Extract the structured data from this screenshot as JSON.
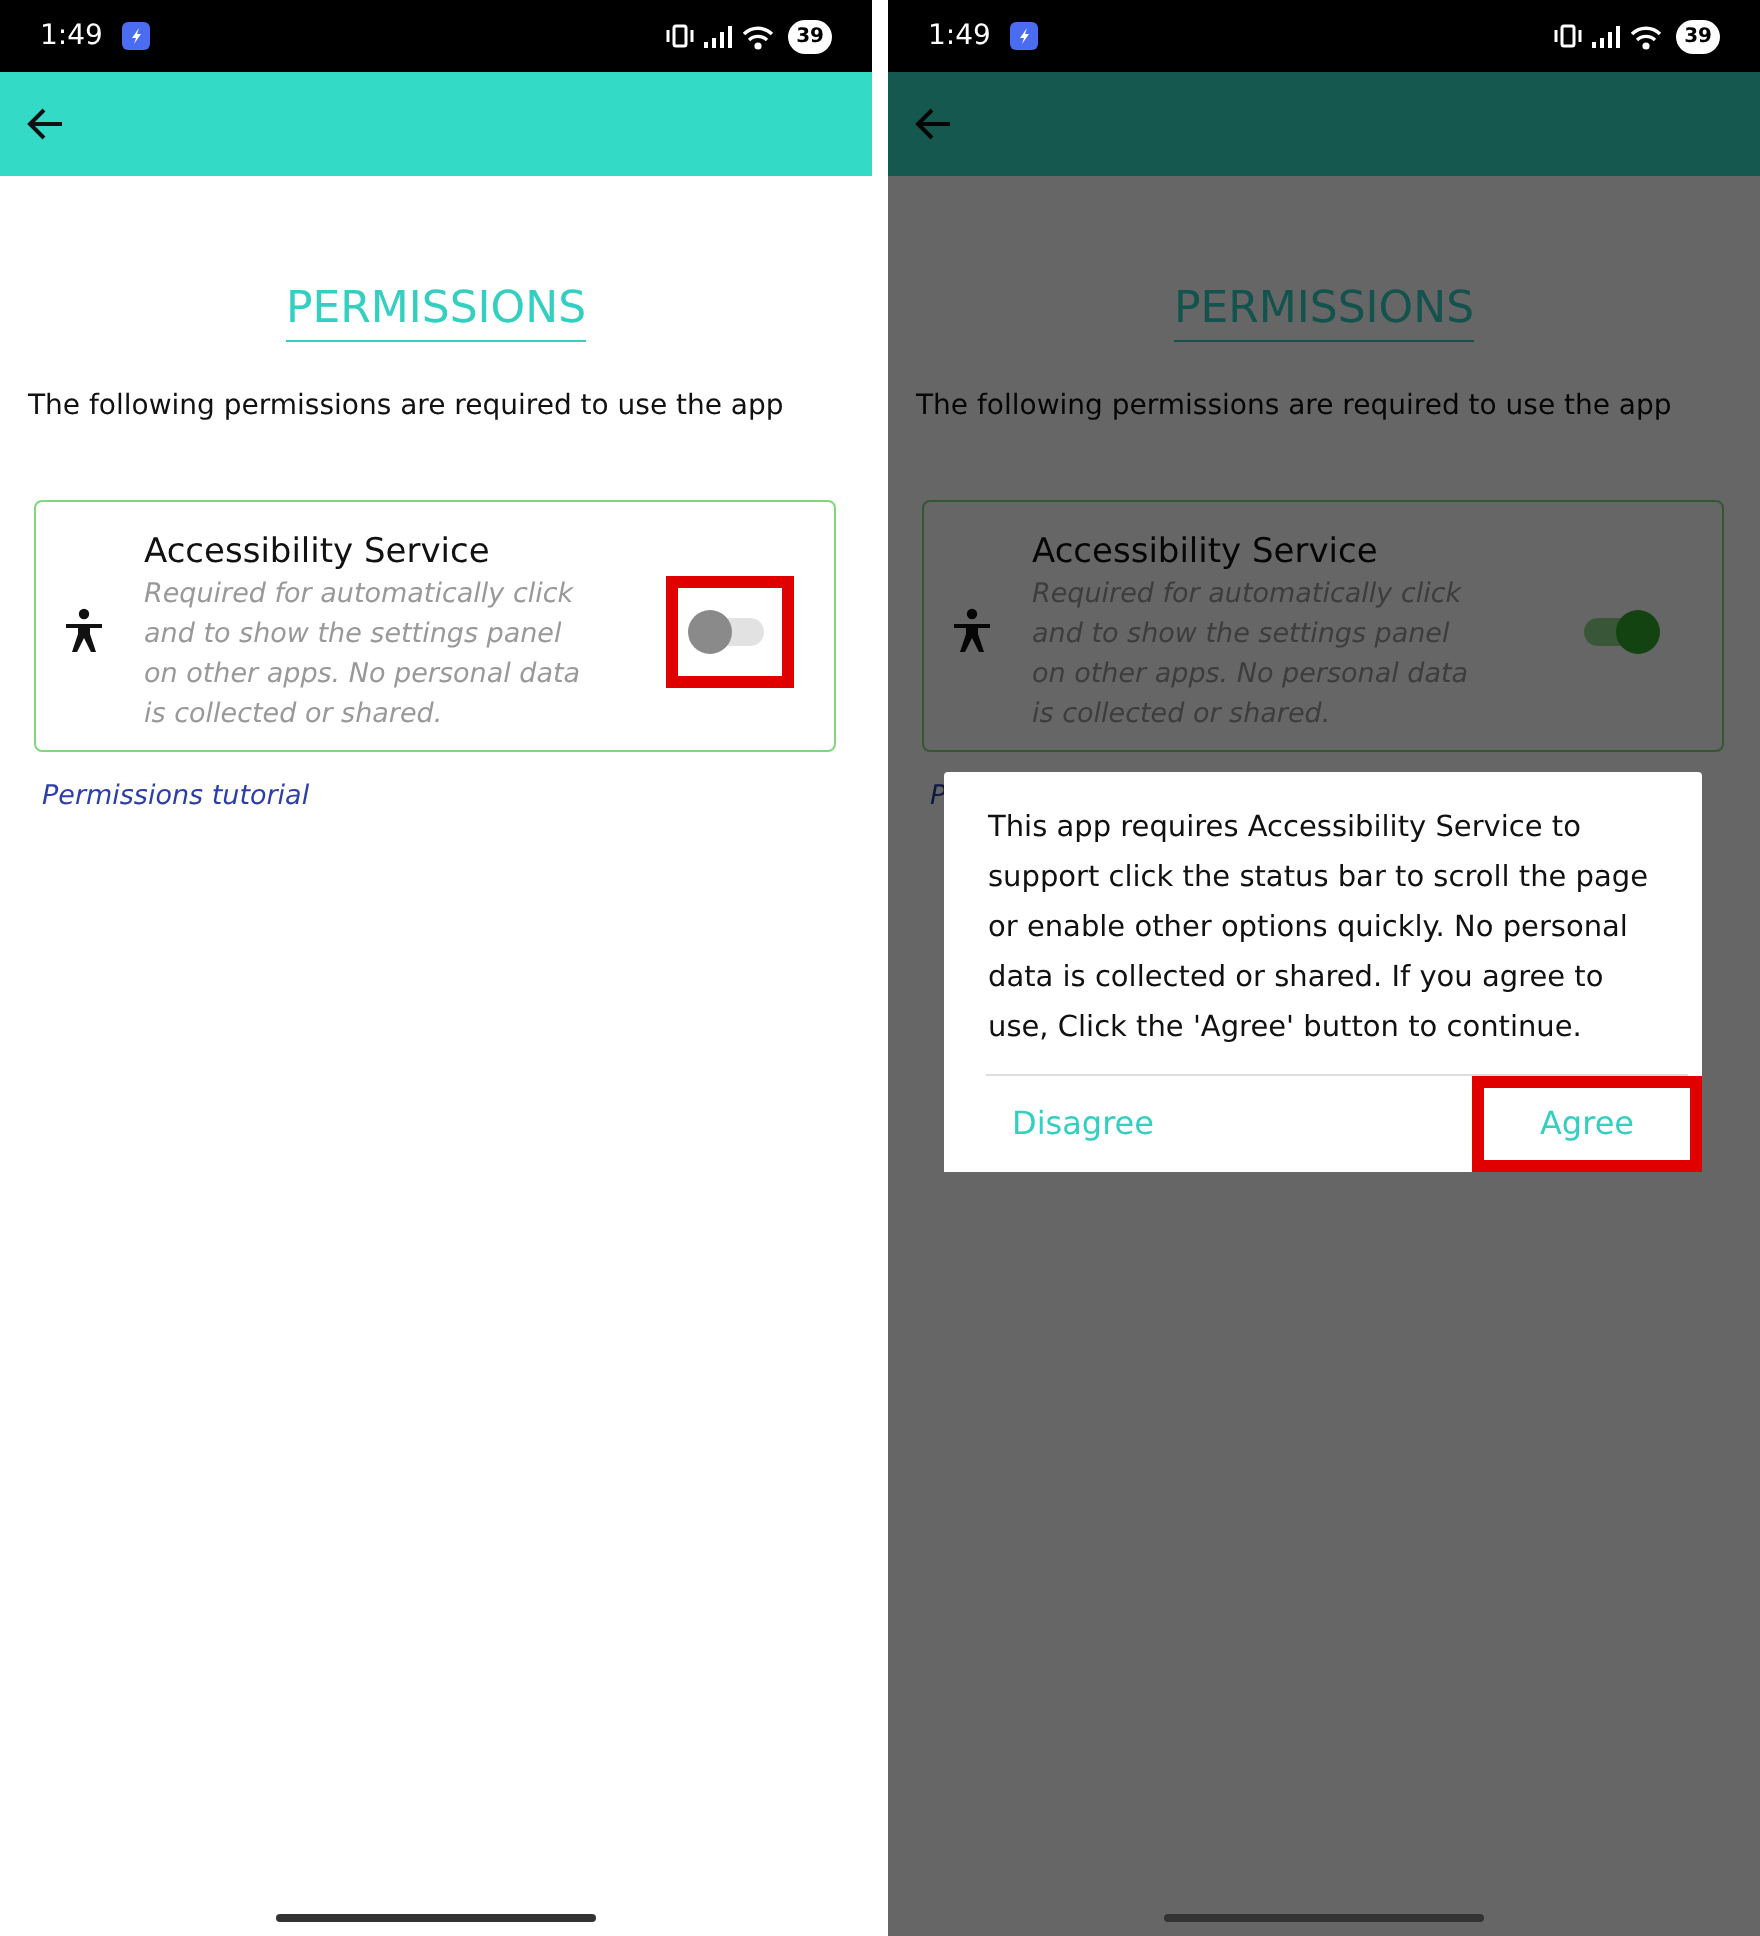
{
  "screens": [
    {
      "status_bar": {
        "time": "1:49",
        "battery": "39"
      },
      "title": "PERMISSIONS",
      "intro": "The following permissions are required to use the app",
      "permissions": [
        {
          "name": "Accessibility Service",
          "description": "Required for automatically click and to show the settings panel on other apps. No personal data is collected or shared.",
          "on": false,
          "highlighted": true
        }
      ],
      "tutorial_link": "Permissions tutorial",
      "dimmed": false
    },
    {
      "status_bar": {
        "time": "1:49",
        "battery": "39"
      },
      "title": "PERMISSIONS",
      "intro": "The following permissions are required to use the app",
      "permissions": [
        {
          "name": "Accessibility Service",
          "description": "Required for automatically click and to show the settings panel on other apps. No personal data is collected or shared.",
          "on": true,
          "highlighted": false
        }
      ],
      "tutorial_link": "P",
      "dimmed": true,
      "dialog": {
        "message": "This app requires Accessibility Service to support click the status bar to scroll the page or enable other options quickly. No personal data is collected or shared. If you agree to use, Click the 'Agree' button to continue.",
        "buttons": [
          {
            "label": "Disagree",
            "highlighted": false
          },
          {
            "label": "Agree",
            "highlighted": true
          }
        ]
      }
    }
  ]
}
